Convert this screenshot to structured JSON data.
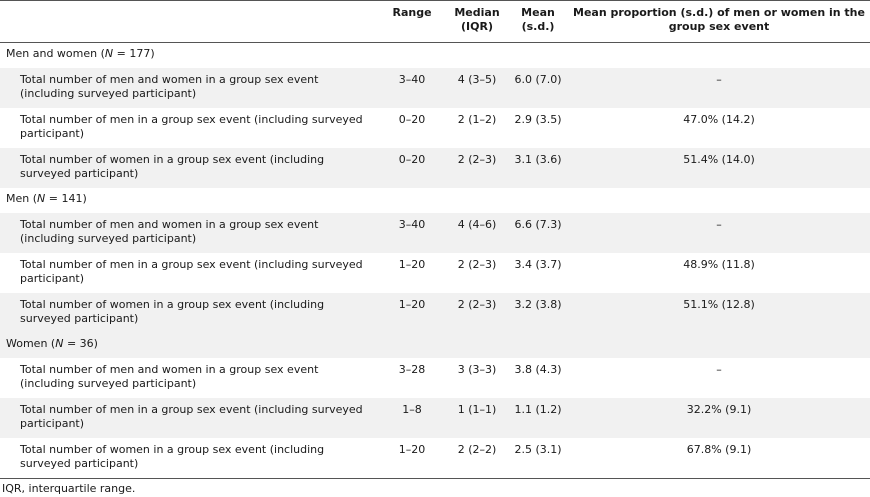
{
  "headers": {
    "label": "",
    "range": "Range",
    "median": "Median (IQR)",
    "mean": "Mean (s.d.)",
    "proportion": "Mean proportion (s.d.) of men or women in the group sex event"
  },
  "groups": [
    {
      "label_prefix": "Men and women (",
      "label_n": "N",
      "label_suffix": " = 177)",
      "rows": [
        {
          "label": "Total number of men and women in a group sex event (including surveyed participant)",
          "range": "3–40",
          "median": "4 (3–5)",
          "mean": "6.0 (7.0)",
          "proportion": "–"
        },
        {
          "label": "Total number of men in a group sex event (including surveyed participant)",
          "range": "0–20",
          "median": "2 (1–2)",
          "mean": "2.9 (3.5)",
          "proportion": "47.0% (14.2)"
        },
        {
          "label": "Total number of women in a group sex event (including surveyed participant)",
          "range": "0–20",
          "median": "2 (2–3)",
          "mean": "3.1 (3.6)",
          "proportion": "51.4% (14.0)"
        }
      ]
    },
    {
      "label_prefix": "Men (",
      "label_n": "N",
      "label_suffix": " = 141)",
      "rows": [
        {
          "label": "Total number of men and women in a group sex event (including surveyed participant)",
          "range": "3–40",
          "median": "4 (4–6)",
          "mean": "6.6 (7.3)",
          "proportion": "–"
        },
        {
          "label": "Total number of men in a group sex event (including surveyed participant)",
          "range": "1–20",
          "median": "2 (2–3)",
          "mean": "3.4 (3.7)",
          "proportion": "48.9% (11.8)"
        },
        {
          "label": "Total number of women in a group sex event (including surveyed participant)",
          "range": "1–20",
          "median": "2 (2–3)",
          "mean": "3.2 (3.8)",
          "proportion": "51.1% (12.8)"
        }
      ]
    },
    {
      "label_prefix": "Women (",
      "label_n": "N",
      "label_suffix": " = 36)",
      "rows": [
        {
          "label": "Total number of men and women in a group sex event (including surveyed participant)",
          "range": "3–28",
          "median": "3 (3–3)",
          "mean": "3.8 (4.3)",
          "proportion": "–"
        },
        {
          "label": "Total number of men in a group sex event (including surveyed participant)",
          "range": "1–8",
          "median": "1 (1–1)",
          "mean": "1.1 (1.2)",
          "proportion": "32.2% (9.1)"
        },
        {
          "label": "Total number of women in a group sex event (including surveyed participant)",
          "range": "1–20",
          "median": "2 (2–2)",
          "mean": "2.5 (3.1)",
          "proportion": "67.8% (9.1)"
        }
      ]
    }
  ],
  "footnote": "IQR, interquartile range."
}
